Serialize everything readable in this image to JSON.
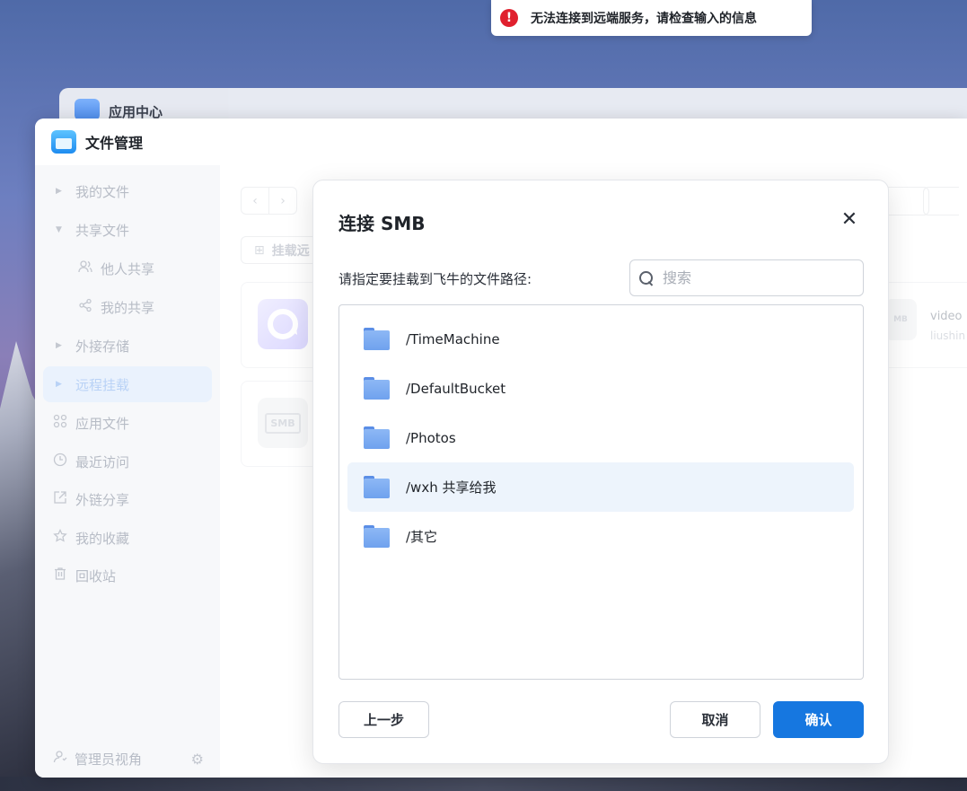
{
  "toast": {
    "message": "无法连接到远端服务，请检查输入的信息",
    "icon": "error-icon",
    "color": "#e0202e"
  },
  "back_window": {
    "title": "应用中心"
  },
  "window": {
    "title": "文件管理"
  },
  "sidebar": {
    "items": [
      {
        "label": "我的文件",
        "icon": "caret-right-icon"
      },
      {
        "label": "共享文件",
        "icon": "caret-down-icon"
      },
      {
        "label": "他人共享",
        "icon": "users-icon"
      },
      {
        "label": "我的共享",
        "icon": "share-icon"
      },
      {
        "label": "外接存储",
        "icon": "caret-right-icon"
      },
      {
        "label": "远程挂载",
        "icon": "caret-right-icon"
      },
      {
        "label": "应用文件",
        "icon": "apps-icon"
      },
      {
        "label": "最近访问",
        "icon": "clock-icon"
      },
      {
        "label": "外链分享",
        "icon": "external-link-icon"
      },
      {
        "label": "我的收藏",
        "icon": "star-icon"
      },
      {
        "label": "回收站",
        "icon": "trash-icon"
      }
    ],
    "footer_label": "管理员视角"
  },
  "main": {
    "mount_button_label": "挂载远",
    "card_label": "SMB",
    "right_card": {
      "title": "video",
      "subtitle": "liushin",
      "icon_label": "MB"
    }
  },
  "dialog": {
    "title": "连接 SMB",
    "label": "请指定要挂载到飞牛的文件路径:",
    "search_placeholder": "搜索",
    "search_value": "",
    "folders": [
      {
        "name": "/TimeMachine",
        "selected": false
      },
      {
        "name": "/DefaultBucket",
        "selected": false
      },
      {
        "name": "/Photos",
        "selected": false
      },
      {
        "name": "/wxh 共享给我",
        "selected": true
      },
      {
        "name": "/其它",
        "selected": false
      }
    ],
    "prev_label": "上一步",
    "cancel_label": "取消",
    "confirm_label": "确认",
    "accent_color": "#1677e0"
  }
}
